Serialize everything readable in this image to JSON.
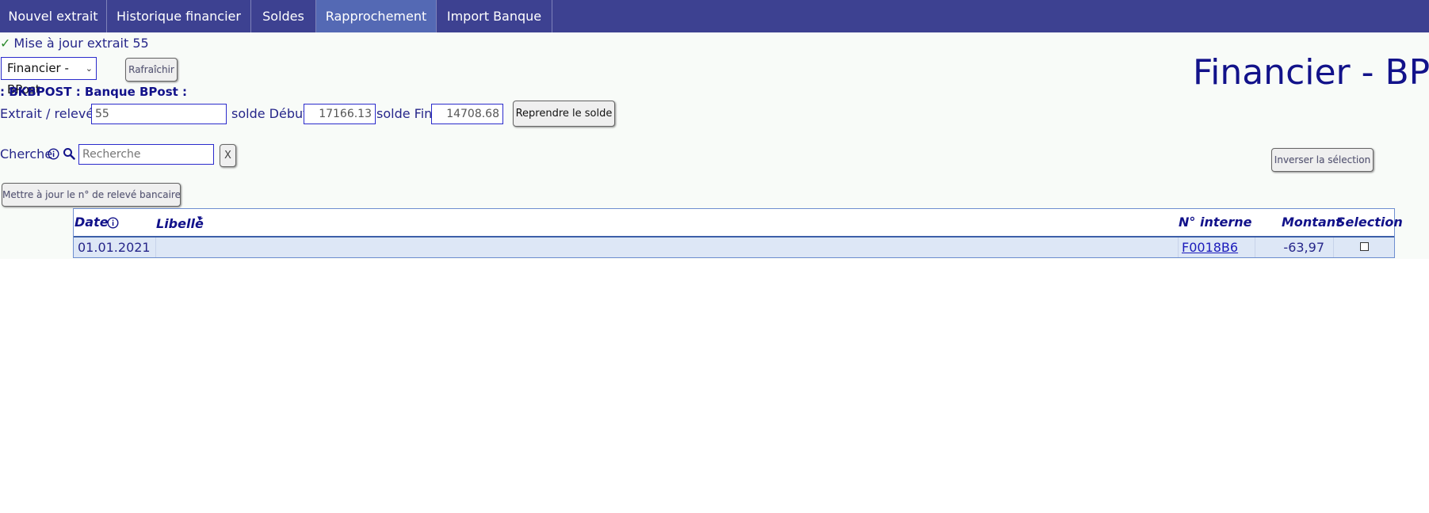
{
  "nav": {
    "tabs": [
      {
        "label": "Nouvel extrait"
      },
      {
        "label": "Historique financier"
      },
      {
        "label": "Soldes"
      },
      {
        "label": "Rapprochement"
      },
      {
        "label": "Import Banque"
      }
    ]
  },
  "status": {
    "check": "✓",
    "message": "Mise à jour extrait 55"
  },
  "journal": {
    "selected": "Financier - BPost",
    "refresh_label": "Rafraîchir"
  },
  "page_title": "Financier - BPost",
  "bank_line": ": BKBPOST : Banque BPost :",
  "statement": {
    "label": "Extrait / relevé :",
    "value": "55",
    "start_label": "solde Début",
    "start_value": "17166.13",
    "end_label": "solde Fin",
    "end_value": "14708.68",
    "resume_label": "Reprendre le solde"
  },
  "search": {
    "label": "Cherche",
    "placeholder": "Recherche",
    "clear_label": "X"
  },
  "invert_label": "Inverser la sélection",
  "update_number_label": "Mettre à jour le n° de relevé bancaire",
  "table": {
    "headers": {
      "date": "Date",
      "libelle": "Libellé",
      "sort": "▾",
      "internal": "N° interne",
      "amount": "Montant",
      "selection": "Selection"
    },
    "rows": [
      {
        "date": "01.01.2021",
        "libelle": "",
        "internal": "F0018B6",
        "amount": "-63,97",
        "selected": false
      }
    ]
  },
  "colors": {
    "nav_bg": "#3d4191",
    "nav_active": "#5469b4",
    "text": "#12128a",
    "row_bg": "#dde7f6"
  }
}
